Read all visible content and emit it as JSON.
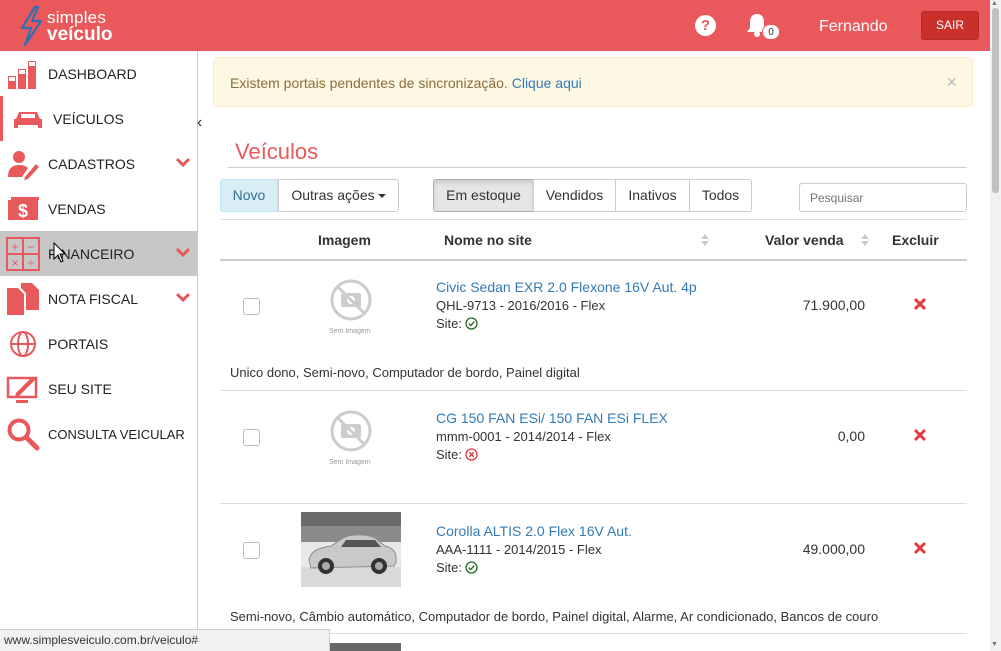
{
  "header": {
    "logo_line1": "simples",
    "logo_line2": "veículo",
    "help": "?",
    "notifications_count": "0",
    "user_name": "Fernando",
    "logout_label": "SAIR",
    "accent_color": "#e9585b"
  },
  "sidebar": {
    "items": [
      {
        "label": "DASHBOARD",
        "icon": "bar-chart-icon"
      },
      {
        "label": "VEÍCULOS",
        "icon": "car-icon"
      },
      {
        "label": "CADASTROS",
        "icon": "user-edit-icon"
      },
      {
        "label": "VENDAS",
        "icon": "money-icon"
      },
      {
        "label": "FINANCEIRO",
        "icon": "calculator-icon"
      },
      {
        "label": "NOTA FISCAL",
        "icon": "documents-icon"
      },
      {
        "label": "PORTAIS",
        "icon": "globe-icon"
      },
      {
        "label": "SEU SITE",
        "icon": "monitor-edit-icon"
      },
      {
        "label": "CONSULTA VEICULAR",
        "icon": "magnifier-icon"
      }
    ],
    "collapse": "‹"
  },
  "alert": {
    "text": "Existem portais pendentes de sincronização.",
    "link": "Clique aqui",
    "close": "×"
  },
  "main": {
    "title": "Veículos",
    "btn_new": "Novo",
    "btn_more": "Outras ações",
    "filters": [
      "Em estoque",
      "Vendidos",
      "Inativos",
      "Todos"
    ],
    "search_placeholder": "Pesquisar",
    "columns": {
      "image": "Imagem",
      "name": "Nome no site",
      "price": "Valor venda",
      "delete": "Excluir"
    },
    "no_image_text": "Sem Imagem",
    "site_label": "Site:",
    "rows": [
      {
        "name": "Civic Sedan EXR 2.0 Flexone 16V Aut. 4p",
        "sub": "QHL-9713 - 2016/2016 - Flex",
        "site_status": "ok",
        "price": "71.900,00",
        "features": "Unico dono, Semi-novo, Computador de bordo, Painel digital"
      },
      {
        "name": "CG 150 FAN ESi/ 150 FAN ESi FLEX",
        "sub": "mmm-0001 - 2014/2014 - Flex",
        "site_status": "error",
        "price": "0,00",
        "features": ""
      },
      {
        "name": "Corolla ALTIS 2.0 Flex 16V Aut.",
        "sub": "AAA-1111 - 2014/2015 - Flex",
        "site_status": "ok",
        "price": "49.000,00",
        "features": "Semi-novo, Câmbio automático, Computador de bordo, Painel digital, Alarme, Ar condicionado, Bancos de couro"
      }
    ]
  },
  "statusbar": {
    "url": "www.simplesveiculo.com.br/veiculo#"
  }
}
